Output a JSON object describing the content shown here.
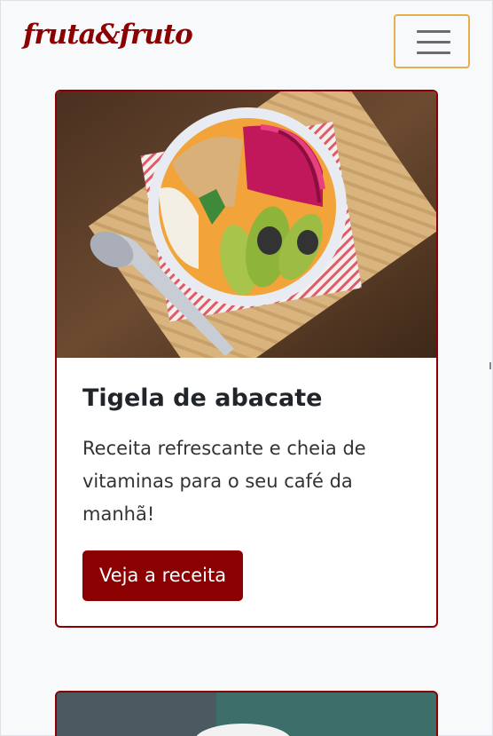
{
  "navbar": {
    "brand": "fruta&fruto",
    "toggler_icon": "hamburger-menu-icon"
  },
  "card": {
    "title": "Tigela de abacate",
    "text": "Receita refrescante e cheia de vitaminas para o seu café da manhã!",
    "button_label": "Veja a receita"
  },
  "colors": {
    "brand": "#8b0000",
    "toggler_border": "#e8b04a",
    "background": "#f8f9fa"
  }
}
